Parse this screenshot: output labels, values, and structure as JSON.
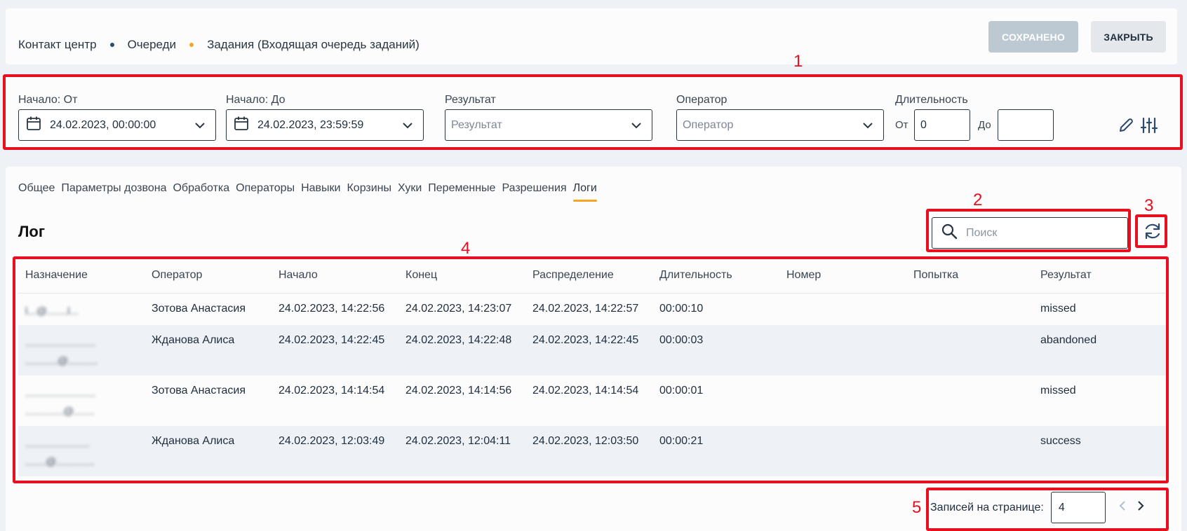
{
  "header": {
    "breadcrumb": [
      "Контакт центр",
      "Очереди",
      "Задания (Входящая очередь заданий)"
    ],
    "saved_label": "СОХРАНЕНО",
    "close_label": "ЗАКРЫТЬ"
  },
  "filters": {
    "start_from_label": "Начало: От",
    "start_from_value": "24.02.2023, 00:00:00",
    "start_to_label": "Начало: До",
    "start_to_value": "24.02.2023, 23:59:59",
    "result_label": "Результат",
    "result_placeholder": "Результат",
    "operator_label": "Оператор",
    "operator_placeholder": "Оператор",
    "duration_label": "Длительность",
    "from_label": "От",
    "from_value": "0",
    "to_label": "До",
    "to_value": ""
  },
  "tabs": [
    "Общее",
    "Параметры дозвона",
    "Обработка",
    "Операторы",
    "Навыки",
    "Корзины",
    "Хуки",
    "Переменные",
    "Разрешения",
    "Логи"
  ],
  "active_tab": "Логи",
  "log": {
    "title": "Лог",
    "search_placeholder": "Поиск",
    "columns": [
      "Назначение",
      "Оператор",
      "Начало",
      "Конец",
      "Распределение",
      "Длительность",
      "Номер",
      "Попытка",
      "Результат"
    ],
    "rows": [
      {
        "dest": [
          "l...@.......l..."
        ],
        "operator": "Зотова Анастасия",
        "start": "24.02.2023, 14:22:56",
        "end": "24.02.2023, 14:23:07",
        "distribution": "24.02.2023, 14:22:57",
        "duration": "00:00:10",
        "number": "",
        "attempt": "",
        "result": "missed"
      },
      {
        "dest": [
          "........................",
          "...........@.........."
        ],
        "operator": "Жданова Алиса",
        "start": "24.02.2023, 14:22:45",
        "end": "24.02.2023, 14:22:48",
        "distribution": "24.02.2023, 14:22:45",
        "duration": "00:00:03",
        "number": "",
        "attempt": "",
        "result": "abandoned"
      },
      {
        "dest": [
          "........................",
          ".............@......."
        ],
        "operator": "Зотова Анастасия",
        "start": "24.02.2023, 14:14:54",
        "end": "24.02.2023, 14:14:56",
        "distribution": "24.02.2023, 14:14:54",
        "duration": "00:00:01",
        "number": "",
        "attempt": "",
        "result": "missed"
      },
      {
        "dest": [
          "......................",
          ".......@............."
        ],
        "operator": "Жданова Алиса",
        "start": "24.02.2023, 12:03:49",
        "end": "24.02.2023, 12:04:11",
        "distribution": "24.02.2023, 12:03:50",
        "duration": "00:00:21",
        "number": "",
        "attempt": "",
        "result": "success"
      }
    ]
  },
  "pager": {
    "label": "Записей на странице:",
    "value": "4"
  },
  "annotations": [
    "1",
    "2",
    "3",
    "4",
    "5"
  ],
  "colors": {
    "accent": "#f5a623",
    "annotation": "#e8101f",
    "saved_button": "#bcc8d2"
  }
}
